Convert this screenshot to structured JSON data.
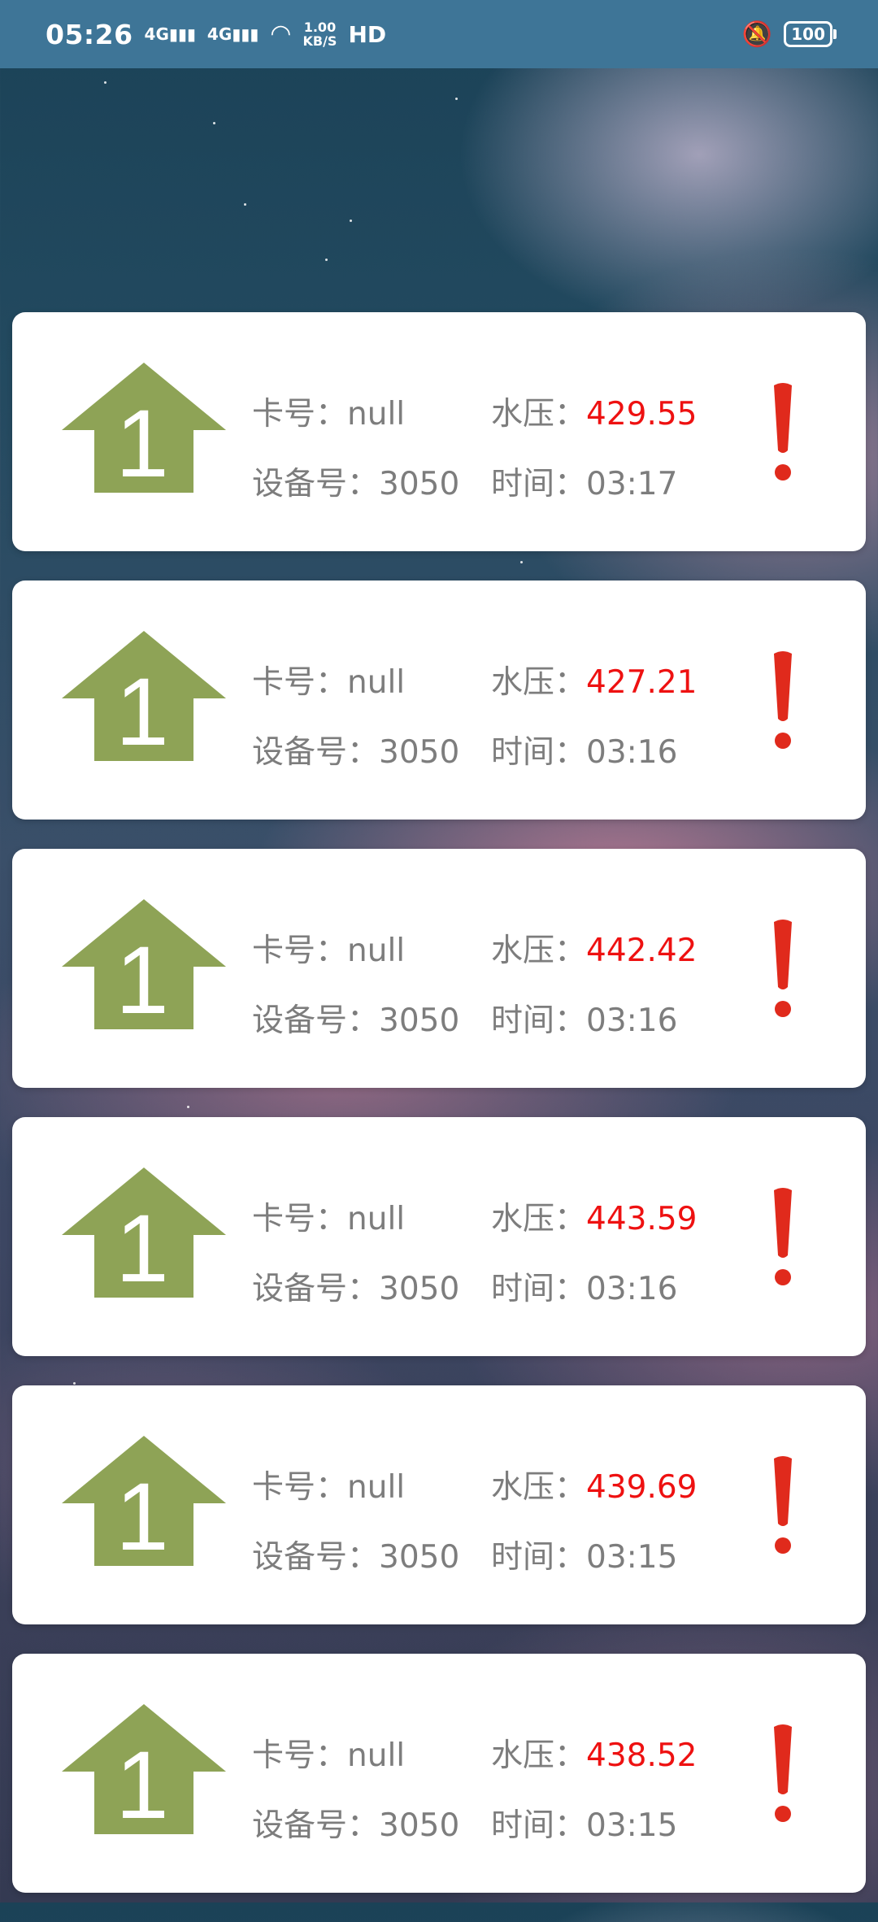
{
  "status_bar": {
    "time": "05:26",
    "signal1": "4G",
    "signal2": "4G",
    "speed_top": "1.00",
    "speed_bottom": "KB/S",
    "hd": "HD",
    "battery": "100"
  },
  "labels": {
    "card": "卡号：",
    "pressure": "水压：",
    "device": "设备号：",
    "time": "时间："
  },
  "records": [
    {
      "badge": "1",
      "card": "null",
      "pressure": "429.55",
      "device": "3050",
      "time": "03:17"
    },
    {
      "badge": "1",
      "card": "null",
      "pressure": "427.21",
      "device": "3050",
      "time": "03:16"
    },
    {
      "badge": "1",
      "card": "null",
      "pressure": "442.42",
      "device": "3050",
      "time": "03:16"
    },
    {
      "badge": "1",
      "card": "null",
      "pressure": "443.59",
      "device": "3050",
      "time": "03:16"
    },
    {
      "badge": "1",
      "card": "null",
      "pressure": "439.69",
      "device": "3050",
      "time": "03:15"
    },
    {
      "badge": "1",
      "card": "null",
      "pressure": "438.52",
      "device": "3050",
      "time": "03:15"
    }
  ],
  "colors": {
    "house": "#8ea356",
    "pressure": "#ee1111",
    "alert": "#e02a1c",
    "status_bar": "#3e7597"
  }
}
